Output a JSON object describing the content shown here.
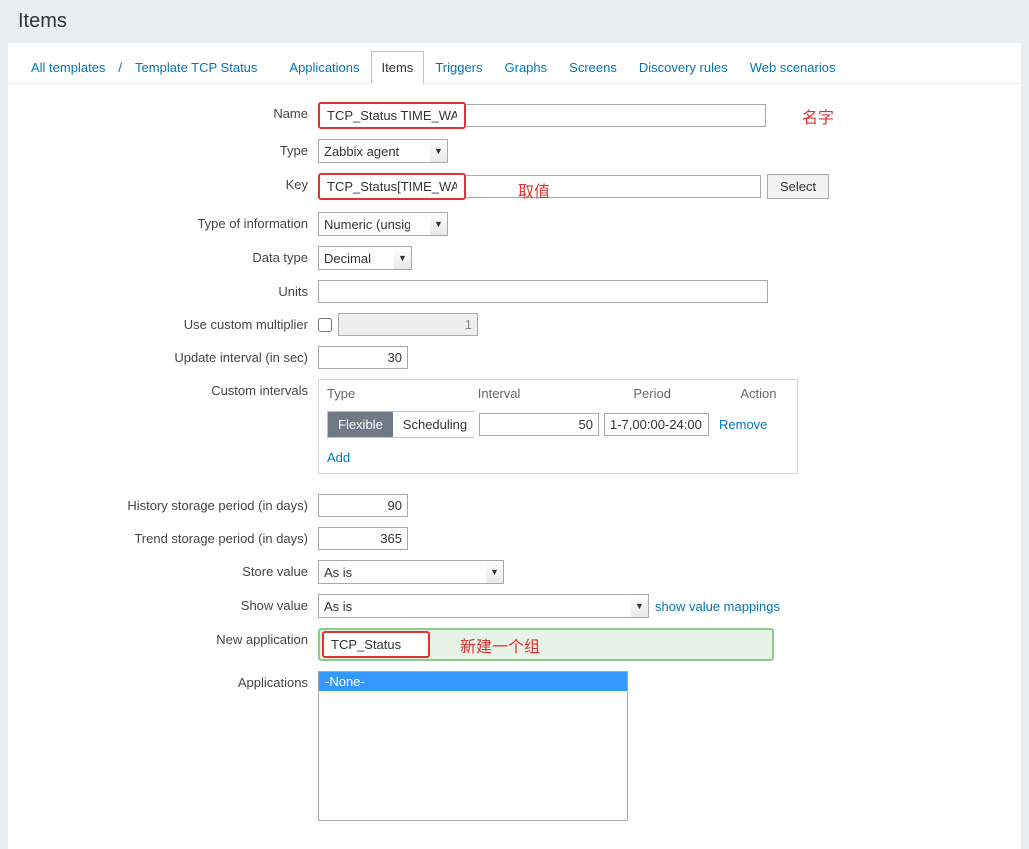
{
  "page_title": "Items",
  "breadcrumb": {
    "all_templates": "All templates",
    "template": "Template TCP Status"
  },
  "tabs": {
    "applications": "Applications",
    "items": "Items",
    "triggers": "Triggers",
    "graphs": "Graphs",
    "screens": "Screens",
    "discovery_rules": "Discovery rules",
    "web_scenarios": "Web scenarios"
  },
  "labels": {
    "name": "Name",
    "type": "Type",
    "key": "Key",
    "type_of_information": "Type of information",
    "data_type": "Data type",
    "units": "Units",
    "use_custom_multiplier": "Use custom multiplier",
    "update_interval": "Update interval (in sec)",
    "custom_intervals": "Custom intervals",
    "history_storage": "History storage period (in days)",
    "trend_storage": "Trend storage period (in days)",
    "store_value": "Store value",
    "show_value": "Show value",
    "new_application": "New application",
    "applications": "Applications"
  },
  "values": {
    "name": "TCP_Status TIME_WAIT",
    "type": "Zabbix agent",
    "key": "TCP_Status[TIME_WAIT]",
    "type_of_information": "Numeric (unsigned)",
    "data_type": "Decimal",
    "units": "",
    "multiplier": "1",
    "update_interval": "30",
    "history_storage": "90",
    "trend_storage": "365",
    "store_value": "As is",
    "show_value": "As is",
    "new_application": "TCP_Status"
  },
  "intervals": {
    "headers": {
      "type": "Type",
      "interval": "Interval",
      "period": "Period",
      "action": "Action"
    },
    "flexible": "Flexible",
    "scheduling": "Scheduling",
    "interval_value": "50",
    "period_value": "1-7,00:00-24:00",
    "remove": "Remove",
    "add": "Add"
  },
  "buttons": {
    "select": "Select",
    "show_value_mappings": "show value mappings"
  },
  "applications_options": {
    "none": "-None-"
  },
  "annotations": {
    "name_note": "名字",
    "key_note": "取值",
    "new_app_note": "新建一个组"
  }
}
